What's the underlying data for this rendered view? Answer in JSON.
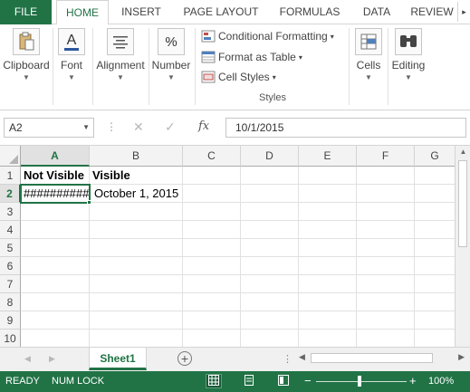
{
  "ribbon_tabs": [
    "FILE",
    "HOME",
    "INSERT",
    "PAGE LAYOUT",
    "FORMULAS",
    "DATA",
    "REVIEW"
  ],
  "ribbon": {
    "clipboard": "Clipboard",
    "font": "Font",
    "alignment": "Alignment",
    "number": "Number",
    "conditional_formatting": "Conditional Formatting",
    "format_as_table": "Format as Table",
    "cell_styles": "Cell Styles",
    "styles_group": "Styles",
    "cells": "Cells",
    "editing": "Editing",
    "number_icon": "%",
    "font_icon": "A"
  },
  "formula_bar": {
    "name_box": "A2",
    "fx": "fx",
    "value": "10/1/2015"
  },
  "grid": {
    "columns": [
      "A",
      "B",
      "C",
      "D",
      "E",
      "F",
      "G"
    ],
    "rows": [
      "1",
      "2",
      "3",
      "4",
      "5",
      "6",
      "7",
      "8",
      "9",
      "10"
    ],
    "cells": {
      "A1": "Not Visible",
      "B1": "Visible",
      "A2": "##########",
      "B2": "October 1, 2015"
    }
  },
  "sheets": {
    "active": "Sheet1",
    "add": "+"
  },
  "status": {
    "ready": "READY",
    "num_lock": "NUM LOCK",
    "zoom": "100%",
    "zoom_level": 1.0
  },
  "colors": {
    "accent": "#217346"
  }
}
